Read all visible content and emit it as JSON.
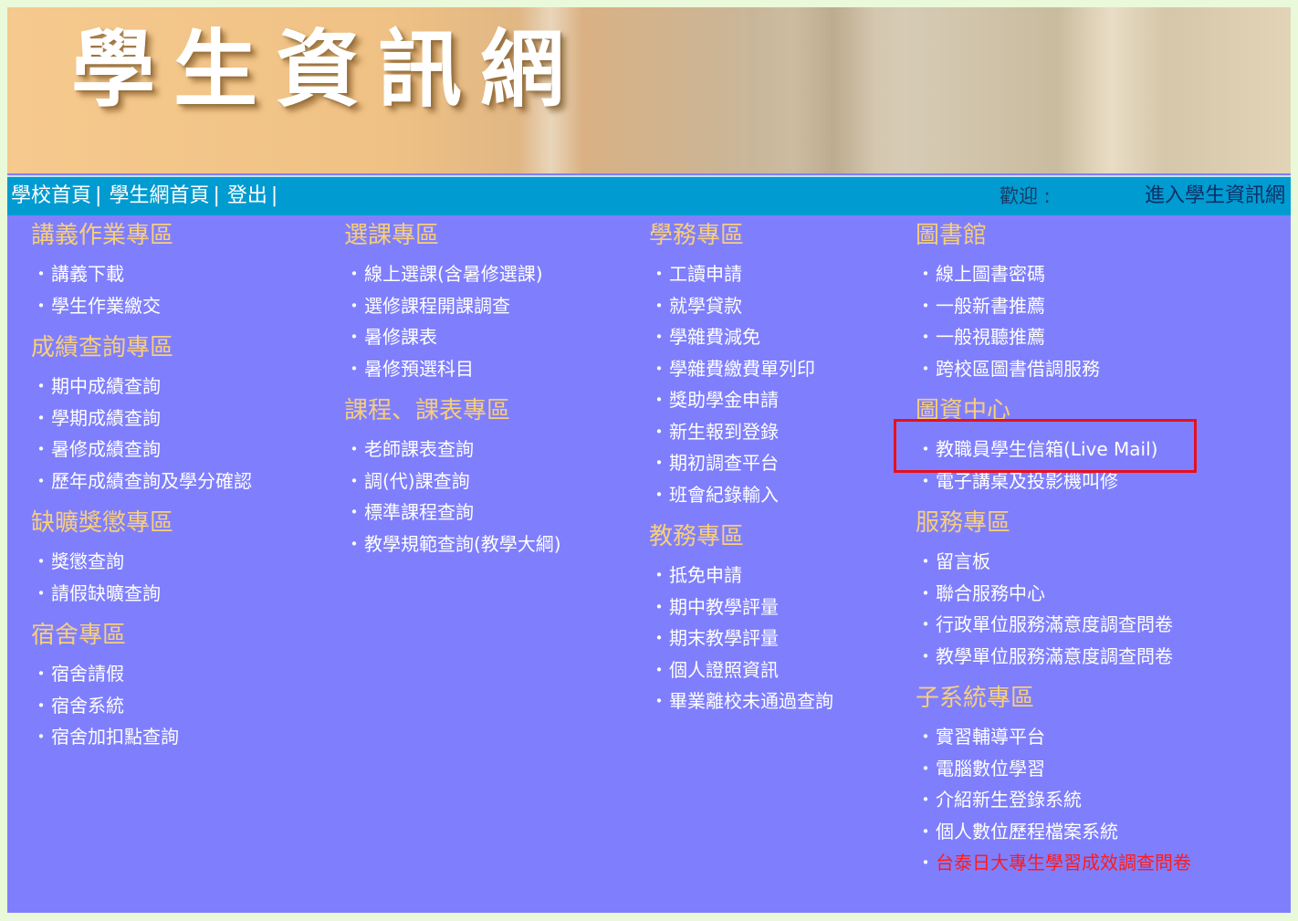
{
  "header": {
    "banner_title": "學生資訊網"
  },
  "navbar": {
    "links": [
      "學校首頁",
      "學生網首頁",
      "登出"
    ],
    "separator": "|",
    "welcome": "歡迎 :",
    "enter_link": "進入學生資訊網"
  },
  "bullet": "・",
  "columns": [
    [
      {
        "title": "講義作業專區",
        "items": [
          "講義下載",
          "學生作業繳交"
        ]
      },
      {
        "title": "成績查詢專區",
        "items": [
          "期中成績查詢",
          "學期成績查詢",
          "暑修成績查詢",
          "歷年成績查詢及學分確認"
        ]
      },
      {
        "title": "缺曠獎懲專區",
        "items": [
          "獎懲查詢",
          "請假缺曠查詢"
        ]
      },
      {
        "title": "宿舍專區",
        "items": [
          "宿舍請假",
          "宿舍系統",
          "宿舍加扣點查詢"
        ]
      }
    ],
    [
      {
        "title": "選課專區",
        "items": [
          "線上選課(含暑修選課)",
          "選修課程開課調查",
          "暑修課表",
          "暑修預選科目"
        ]
      },
      {
        "title": "課程、課表專區",
        "items": [
          "老師課表查詢",
          "調(代)課查詢",
          "標準課程查詢",
          "教學規範查詢(教學大綱)"
        ]
      }
    ],
    [
      {
        "title": "學務專區",
        "items": [
          "工讀申請",
          "就學貸款",
          "學雜費減免",
          "學雜費繳費單列印",
          "獎助學金申請",
          "新生報到登錄",
          "期初調查平台",
          "班會紀錄輸入"
        ]
      },
      {
        "title": "教務專區",
        "items": [
          "抵免申請",
          "期中教學評量",
          "期末教學評量",
          "個人證照資訊",
          "畢業離校未通過查詢"
        ]
      }
    ],
    [
      {
        "title": "圖書館",
        "items": [
          "線上圖書密碼",
          "一般新書推薦",
          "一般視聽推薦",
          "跨校區圖書借調服務"
        ]
      },
      {
        "title": "圖資中心",
        "items": [
          "教職員學生信箱(Live Mail)",
          "電子講桌及投影機叫修"
        ]
      },
      {
        "title": "服務專區",
        "items": [
          "留言板",
          "聯合服務中心",
          "行政單位服務滿意度調查問卷",
          "教學單位服務滿意度調查問卷"
        ]
      },
      {
        "title": "子系統專區",
        "items": [
          "實習輔導平台",
          "電腦數位學習",
          "介紹新生登錄系統",
          "個人數位歷程檔案系統",
          "台泰日大專生學習成效調查問卷"
        ]
      }
    ]
  ],
  "colors": {
    "content_bg": "#7f7ffe",
    "section_title": "#f7ce7b",
    "link": "#ffffff",
    "alert_link": "#ff1a1a",
    "navbar": "#009bd0",
    "highlight_box": "#e6101e"
  }
}
